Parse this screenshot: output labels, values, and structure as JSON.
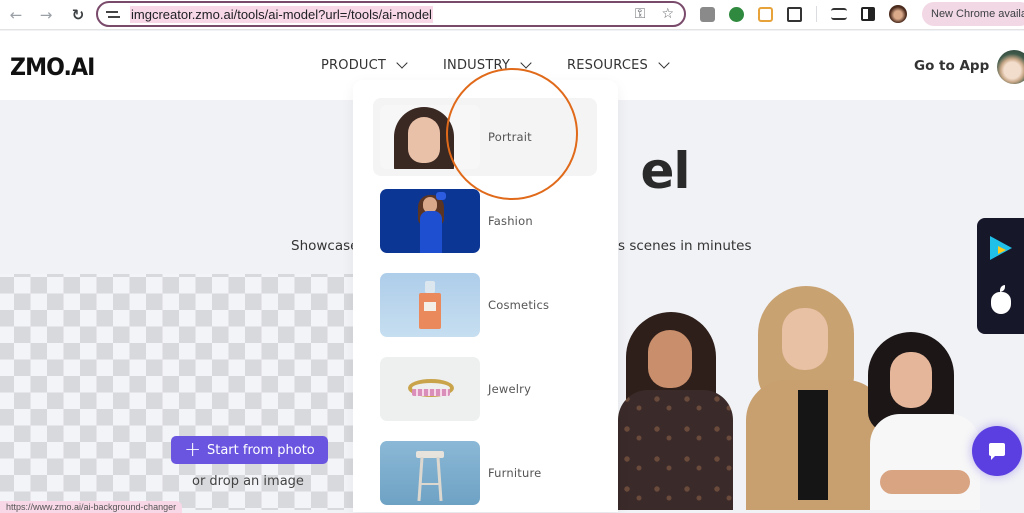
{
  "browser": {
    "url": "imgcreator.zmo.ai/tools/ai-model?url=/tools/ai-model",
    "update_label": "New Chrome available",
    "status_url": "https://www.zmo.ai/ai-background-changer",
    "icons": [
      "back-arrow",
      "forward-arrow",
      "reload",
      "site-info",
      "password-key",
      "bookmark-star",
      "extension-gray",
      "extension-green",
      "extension-orange",
      "extensions-puzzle",
      "media-control",
      "side-panel",
      "profile"
    ]
  },
  "header": {
    "logo": "ZMO.AI",
    "menu": [
      {
        "label": "PRODUCT"
      },
      {
        "label": "INDUSTRY"
      },
      {
        "label": "RESOURCES"
      }
    ],
    "cta": "Go to App"
  },
  "hero": {
    "title_visible": "el",
    "subtitle_left": "Showcase",
    "subtitle_right": "s scenes in minutes"
  },
  "upload": {
    "button_label": "Start from photo",
    "drop_text": "or drop an image"
  },
  "industry_dropdown": {
    "items": [
      {
        "label": "Portrait",
        "active": true
      },
      {
        "label": "Fashion",
        "active": false
      },
      {
        "label": "Cosmetics",
        "active": false
      },
      {
        "label": "Jewelry",
        "active": false
      },
      {
        "label": "Furniture",
        "active": false
      }
    ]
  },
  "colors": {
    "accent": "#6a55e0",
    "chat": "#5b3fe0",
    "annotation": "#e06a1a",
    "app_panel": "#17172a"
  }
}
